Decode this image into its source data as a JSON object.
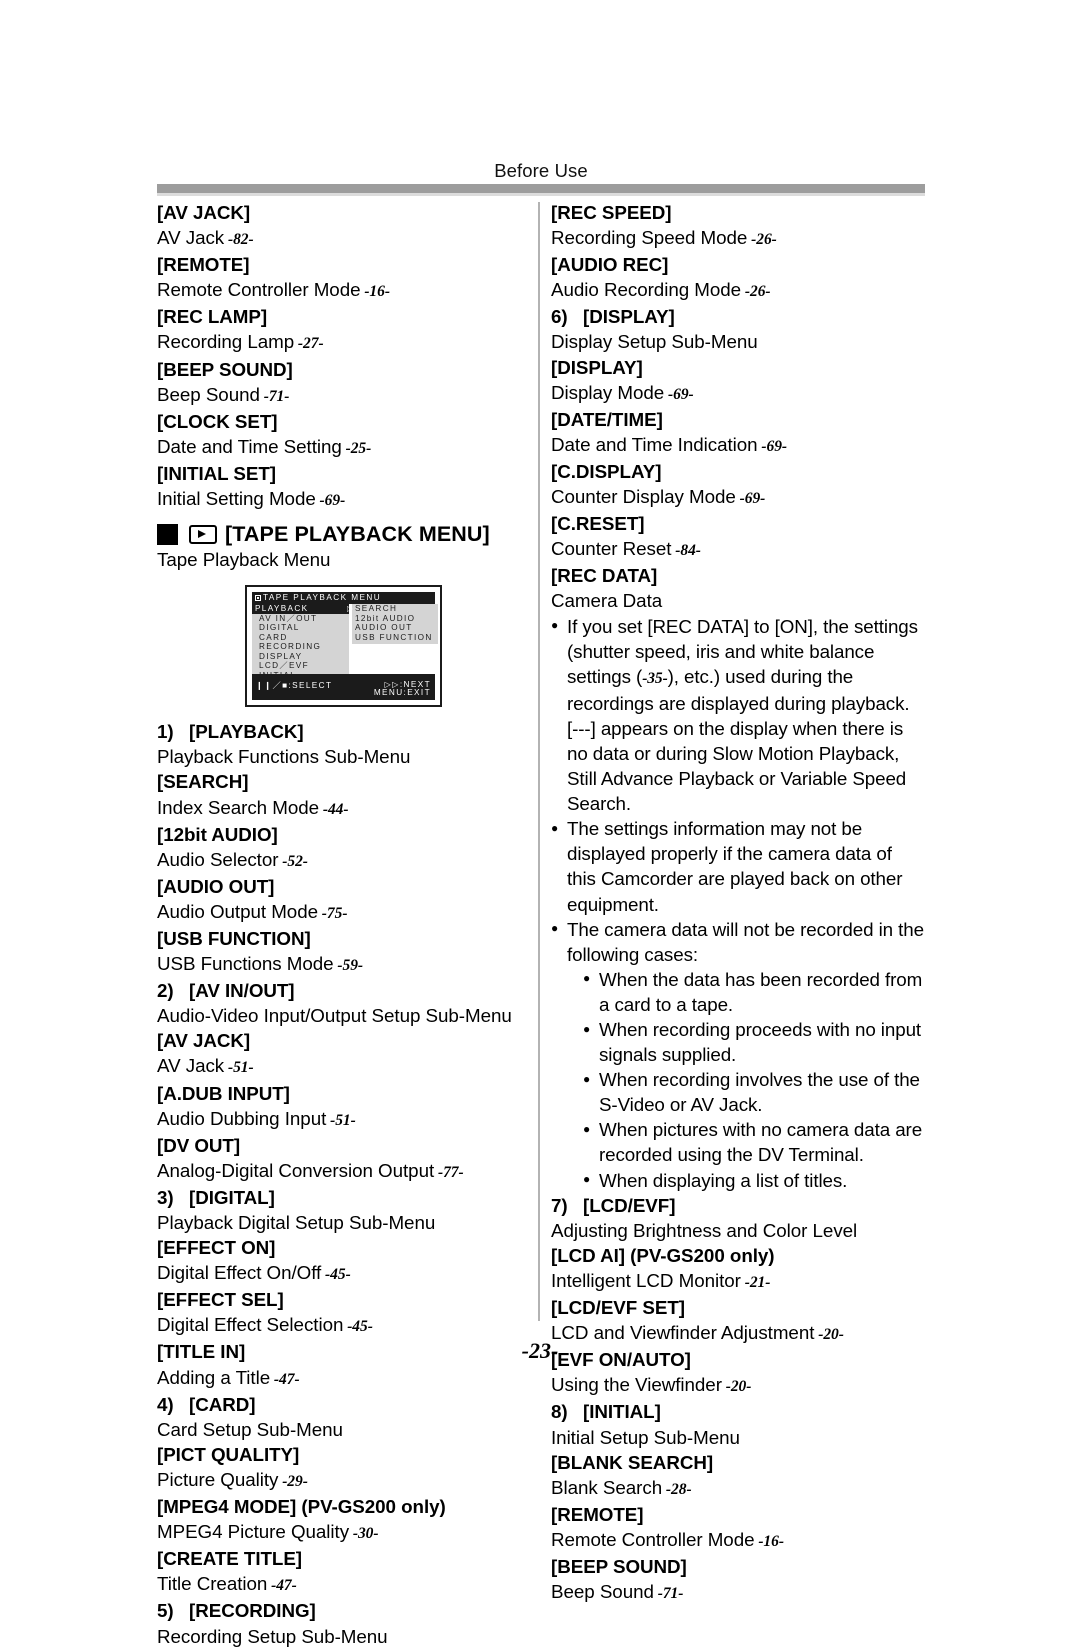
{
  "header": {
    "running_head": "Before Use"
  },
  "footer": {
    "page_number": "-23-"
  },
  "left_column": {
    "top_entries": [
      {
        "term": "[AV JACK]",
        "desc": "AV Jack",
        "page": "-82-"
      },
      {
        "term": "[REMOTE]",
        "desc": "Remote Controller Mode",
        "page": "-16-"
      },
      {
        "term": "[REC LAMP]",
        "desc": "Recording Lamp",
        "page": "-27-"
      },
      {
        "term": "[BEEP SOUND]",
        "desc": "Beep Sound",
        "page": "-71-"
      },
      {
        "term": "[CLOCK SET]",
        "desc": "Date and Time Setting",
        "page": "-25-"
      },
      {
        "term": "[INITIAL SET]",
        "desc": "Initial Setting Mode",
        "page": "-69-"
      }
    ],
    "section": {
      "title": "[TAPE PLAYBACK MENU]",
      "subtitle": "Tape Playback Menu",
      "square_icon": "black-square-icon",
      "play_icon": "play-mode-icon"
    },
    "menu_screenshot": {
      "title": "TAPE  PLAYBACK  MENU",
      "left_items": [
        "PLAYBACK",
        "AV  IN／OUT",
        "DIGITAL",
        "CARD",
        "RECORDING",
        "DISPLAY",
        "LCD／EVF",
        "INITIAL"
      ],
      "selected_left_item": "PLAYBACK",
      "right_items": [
        "SEARCH",
        "12bit  AUDIO",
        "AUDIO  OUT",
        "USB  FUNCTION"
      ],
      "footer_left": "❙❙／■:SELECT",
      "footer_right_1": "▷▷:NEXT",
      "footer_right_2": "MENU:EXIT"
    },
    "entries": [
      {
        "num": "1)",
        "term": "[PLAYBACK]",
        "desc": "Playback Functions Sub-Menu",
        "page": ""
      },
      {
        "num": "",
        "term": "[SEARCH]",
        "desc": "Index Search Mode",
        "page": "-44-"
      },
      {
        "num": "",
        "term": "[12bit AUDIO]",
        "desc": "Audio Selector",
        "page": "-52-"
      },
      {
        "num": "",
        "term": "[AUDIO OUT]",
        "desc": "Audio Output Mode",
        "page": "-75-"
      },
      {
        "num": "",
        "term": "[USB FUNCTION]",
        "desc": "USB Functions Mode",
        "page": "-59-"
      },
      {
        "num": "2)",
        "term": "[AV IN/OUT]",
        "desc": "Audio-Video Input/Output Setup Sub-Menu",
        "page": ""
      },
      {
        "num": "",
        "term": "[AV JACK]",
        "desc": "AV Jack",
        "page": "-51-"
      },
      {
        "num": "",
        "term": "[A.DUB INPUT]",
        "desc": "Audio Dubbing Input",
        "page": "-51-"
      },
      {
        "num": "",
        "term": "[DV OUT]",
        "desc": "Analog-Digital Conversion Output",
        "page": "-77-"
      },
      {
        "num": "3)",
        "term": "[DIGITAL]",
        "desc": "Playback Digital Setup Sub-Menu",
        "page": ""
      },
      {
        "num": "",
        "term": "[EFFECT ON]",
        "desc": "Digital Effect On/Off",
        "page": "-45-"
      },
      {
        "num": "",
        "term": "[EFFECT SEL]",
        "desc": "Digital Effect Selection",
        "page": "-45-"
      },
      {
        "num": "",
        "term": "[TITLE IN]",
        "desc": "Adding a Title",
        "page": "-47-"
      },
      {
        "num": "4)",
        "term": "[CARD]",
        "desc": "Card Setup Sub-Menu",
        "page": ""
      },
      {
        "num": "",
        "term": "[PICT QUALITY]",
        "desc": "Picture Quality",
        "page": "-29-"
      },
      {
        "num": "",
        "term": "[MPEG4 MODE] (PV-GS200 only)",
        "desc": "MPEG4 Picture Quality",
        "page": "-30-"
      },
      {
        "num": "",
        "term": "[CREATE TITLE]",
        "desc": "Title Creation",
        "page": "-47-"
      },
      {
        "num": "5)",
        "term": "[RECORDING]",
        "desc": "Recording Setup Sub-Menu",
        "page": ""
      }
    ]
  },
  "right_column": {
    "entries_top": [
      {
        "num": "",
        "term": "[REC SPEED]",
        "desc": "Recording Speed Mode",
        "page": "-26-"
      },
      {
        "num": "",
        "term": "[AUDIO REC]",
        "desc": "Audio Recording Mode",
        "page": "-26-"
      },
      {
        "num": "6)",
        "term": "[DISPLAY]",
        "desc": "Display Setup Sub-Menu",
        "page": ""
      },
      {
        "num": "",
        "term": "[DISPLAY]",
        "desc": "Display Mode",
        "page": "-69-"
      },
      {
        "num": "",
        "term": "[DATE/TIME]",
        "desc": "Date and Time Indication",
        "page": "-69-"
      },
      {
        "num": "",
        "term": "[C.DISPLAY]",
        "desc": "Counter Display Mode",
        "page": "-69-"
      },
      {
        "num": "",
        "term": "[C.RESET]",
        "desc": "Counter Reset",
        "page": "-84-"
      },
      {
        "num": "",
        "term": "[REC DATA]",
        "desc": "Camera Data",
        "page": ""
      }
    ],
    "notes": [
      {
        "parts": [
          {
            "t": "If you set [REC DATA] to [ON], the settings (shutter speed, iris and white balance settings ("
          },
          {
            "t": "-35-",
            "style": "page"
          },
          {
            "t": "), etc.) used during the recordings are displayed during playback. [---] appears on the display when there is no data or during Slow Motion Playback, Still Advance Playback or Variable Speed Search."
          }
        ]
      },
      {
        "parts": [
          {
            "t": "The settings information may not be displayed properly if the camera data of this Camcorder are played back on other equipment."
          }
        ]
      },
      {
        "parts": [
          {
            "t": "The camera data will not be recorded in the following cases:"
          }
        ],
        "sub": [
          "When the data has been recorded from a card to a tape.",
          "When recording proceeds with no input signals supplied.",
          "When recording involves the use of the S-Video or AV Jack.",
          "When pictures with no camera data are recorded using the DV Terminal.",
          "When displaying a list of titles."
        ]
      }
    ],
    "entries_bottom": [
      {
        "num": "7)",
        "term": "[LCD/EVF]",
        "desc": "Adjusting Brightness and Color Level",
        "page": ""
      },
      {
        "num": "",
        "term": "[LCD AI] (PV-GS200 only)",
        "desc": "Intelligent LCD Monitor",
        "page": "-21-"
      },
      {
        "num": "",
        "term": "[LCD/EVF SET]",
        "desc": "LCD and Viewfinder Adjustment",
        "page": "-20-"
      },
      {
        "num": "",
        "term": "[EVF ON/AUTO]",
        "desc": "Using the Viewfinder",
        "page": "-20-"
      },
      {
        "num": "8)",
        "term": "[INITIAL]",
        "desc": "Initial Setup Sub-Menu",
        "page": ""
      },
      {
        "num": "",
        "term": "[BLANK SEARCH]",
        "desc": "Blank Search",
        "page": "-28-"
      },
      {
        "num": "",
        "term": "[REMOTE]",
        "desc": "Remote Controller Mode",
        "page": "-16-"
      },
      {
        "num": "",
        "term": "[BEEP SOUND]",
        "desc": "Beep Sound",
        "page": "-71-"
      }
    ]
  }
}
